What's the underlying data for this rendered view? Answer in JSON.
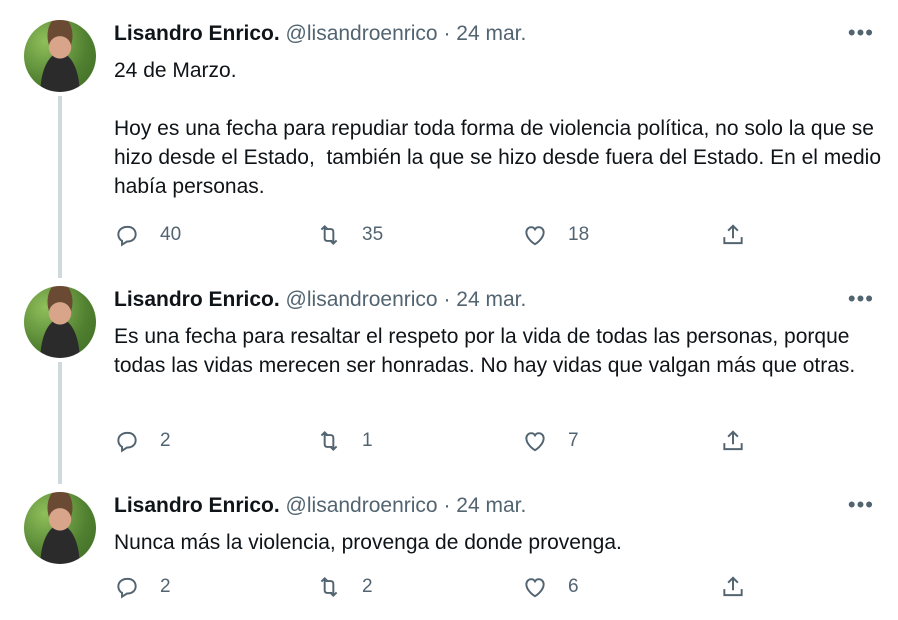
{
  "tweets": [
    {
      "name": "Lisandro Enrico.",
      "handle": "@lisandroenrico",
      "date_sep": " · ",
      "date": "24 mar.",
      "text": "24 de Marzo.\n\nHoy es una fecha para repudiar toda forma de violencia política, no solo la que se hizo desde el Estado,  también la que se hizo desde fuera del Estado. En el medio había personas.",
      "replies": "40",
      "retweets": "35",
      "likes": "18"
    },
    {
      "name": "Lisandro Enrico.",
      "handle": "@lisandroenrico",
      "date_sep": " · ",
      "date": "24 mar.",
      "text": "Es una fecha para resaltar el respeto por la vida de todas las personas, porque todas las vidas merecen ser honradas. No hay vidas que valgan más que otras.",
      "replies": "2",
      "retweets": "1",
      "likes": "7"
    },
    {
      "name": "Lisandro Enrico.",
      "handle": "@lisandroenrico",
      "date_sep": " · ",
      "date": "24 mar.",
      "text": "Nunca más la violencia, provenga de donde provenga.",
      "replies": "2",
      "retweets": "2",
      "likes": "6"
    }
  ],
  "icons": {
    "more": "more-horizontal-icon",
    "reply": "reply-icon",
    "retweet": "retweet-icon",
    "like": "heart-icon",
    "share": "share-icon"
  },
  "colors": {
    "text": "#0f1419",
    "secondary": "#536471",
    "thread_line": "#cfd9de"
  }
}
